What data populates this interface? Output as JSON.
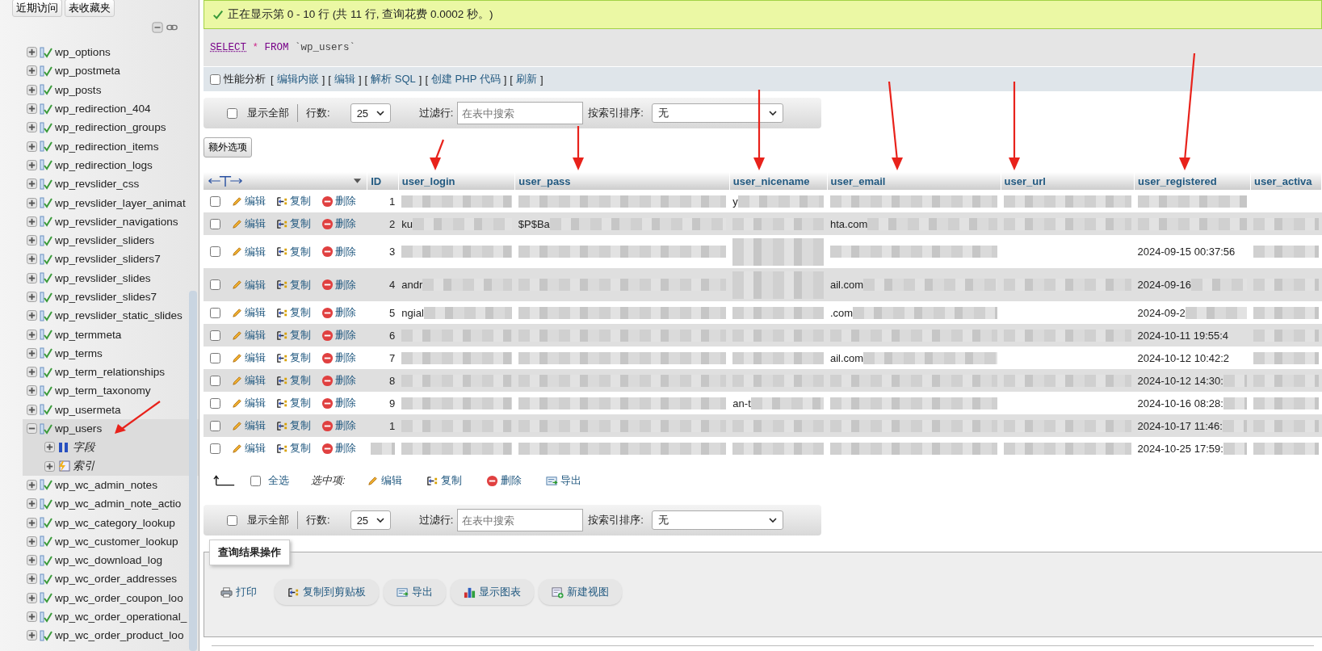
{
  "sidebar": {
    "buttons": [
      "近期访问",
      "表收藏夹"
    ],
    "tables": [
      {
        "name": "wp_options",
        "expanded": false,
        "selected": false,
        "annotated": false
      },
      {
        "name": "wp_postmeta",
        "expanded": false,
        "selected": false,
        "annotated": false
      },
      {
        "name": "wp_posts",
        "expanded": false,
        "selected": false,
        "annotated": false
      },
      {
        "name": "wp_redirection_404",
        "expanded": false,
        "selected": false,
        "annotated": false
      },
      {
        "name": "wp_redirection_groups",
        "expanded": false,
        "selected": false,
        "annotated": false
      },
      {
        "name": "wp_redirection_items",
        "expanded": false,
        "selected": false,
        "annotated": false
      },
      {
        "name": "wp_redirection_logs",
        "expanded": false,
        "selected": false,
        "annotated": false
      },
      {
        "name": "wp_revslider_css",
        "expanded": false,
        "selected": false,
        "annotated": false
      },
      {
        "name": "wp_revslider_layer_animat",
        "expanded": false,
        "selected": false,
        "annotated": false
      },
      {
        "name": "wp_revslider_navigations",
        "expanded": false,
        "selected": false,
        "annotated": false
      },
      {
        "name": "wp_revslider_sliders",
        "expanded": false,
        "selected": false,
        "annotated": false
      },
      {
        "name": "wp_revslider_sliders7",
        "expanded": false,
        "selected": false,
        "annotated": false
      },
      {
        "name": "wp_revslider_slides",
        "expanded": false,
        "selected": false,
        "annotated": false
      },
      {
        "name": "wp_revslider_slides7",
        "expanded": false,
        "selected": false,
        "annotated": false
      },
      {
        "name": "wp_revslider_static_slides",
        "expanded": false,
        "selected": false,
        "annotated": false
      },
      {
        "name": "wp_termmeta",
        "expanded": false,
        "selected": false,
        "annotated": false
      },
      {
        "name": "wp_terms",
        "expanded": false,
        "selected": false,
        "annotated": false
      },
      {
        "name": "wp_term_relationships",
        "expanded": false,
        "selected": false,
        "annotated": false
      },
      {
        "name": "wp_term_taxonomy",
        "expanded": false,
        "selected": false,
        "annotated": false
      },
      {
        "name": "wp_usermeta",
        "expanded": false,
        "selected": false,
        "annotated": false
      },
      {
        "name": "wp_users",
        "expanded": true,
        "selected": true,
        "annotated": true,
        "children": [
          {
            "name": "字段",
            "kind": "columns"
          },
          {
            "name": "索引",
            "kind": "indexes"
          }
        ]
      },
      {
        "name": "wp_wc_admin_notes",
        "expanded": false,
        "selected": false,
        "annotated": false
      },
      {
        "name": "wp_wc_admin_note_actio",
        "expanded": false,
        "selected": false,
        "annotated": false
      },
      {
        "name": "wp_wc_category_lookup",
        "expanded": false,
        "selected": false,
        "annotated": false
      },
      {
        "name": "wp_wc_customer_lookup",
        "expanded": false,
        "selected": false,
        "annotated": false
      },
      {
        "name": "wp_wc_download_log",
        "expanded": false,
        "selected": false,
        "annotated": false
      },
      {
        "name": "wp_wc_order_addresses",
        "expanded": false,
        "selected": false,
        "annotated": false
      },
      {
        "name": "wp_wc_order_coupon_loo",
        "expanded": false,
        "selected": false,
        "annotated": false
      },
      {
        "name": "wp_wc_order_operational_",
        "expanded": false,
        "selected": false,
        "annotated": false
      },
      {
        "name": "wp_wc_order_product_loo",
        "expanded": false,
        "selected": false,
        "annotated": false
      }
    ]
  },
  "message": "正在显示第 0 - 10 行 (共 11 行, 查询花费 0.0002 秒。)",
  "sql": [
    {
      "text": "SELECT",
      "kind": "keyword"
    },
    {
      "text": "*",
      "kind": "operator"
    },
    {
      "text": "FROM",
      "kind": "keyword"
    },
    {
      "text": "`wp_users`",
      "kind": "identifier"
    }
  ],
  "profiling": {
    "label": "性能分析",
    "checked": false,
    "links": [
      {
        "open": "[",
        "label": "编辑内嵌",
        "close": "]"
      },
      {
        "open": "[",
        "label": "编辑",
        "close": "]"
      },
      {
        "open": "[",
        "label": "解析 SQL",
        "close": "]"
      },
      {
        "open": "[",
        "label": "创建 PHP 代码",
        "close": "]"
      },
      {
        "open": "[",
        "label": "刷新",
        "close": "]"
      }
    ]
  },
  "navbars": [
    {
      "show_all": "显示全部",
      "checked": false,
      "rows_label": "行数:",
      "rows_value": "25",
      "filter_label": "过滤行:",
      "filter_placeholder": "在表中搜索",
      "sort_label": "按索引排序:",
      "sort_value": "无"
    },
    {
      "show_all": "显示全部",
      "checked": false,
      "rows_label": "行数:",
      "rows_value": "25",
      "filter_label": "过滤行:",
      "filter_placeholder": "在表中搜索",
      "sort_label": "按索引排序:",
      "sort_value": "无"
    }
  ],
  "extra_options": "额外选项",
  "table": {
    "columns": [
      {
        "label": "ID",
        "annotated": false
      },
      {
        "label": "user_login",
        "annotated": true
      },
      {
        "label": "user_pass",
        "annotated": true
      },
      {
        "label": "user_nicename",
        "annotated": true
      },
      {
        "label": "user_email",
        "annotated": true
      },
      {
        "label": "user_url",
        "annotated": true
      },
      {
        "label": "user_registered",
        "annotated": true
      },
      {
        "label": "user_activa",
        "annotated": false
      }
    ],
    "rows": [
      {
        "checked": false,
        "actions": [
          "编辑",
          "复制",
          "删除"
        ],
        "cells": [
          {
            "text": "1",
            "blurred": false
          },
          {
            "blurred": true
          },
          {
            "blurred": true
          },
          {
            "text": "y",
            "blurred": true
          },
          {
            "blurred": true
          },
          {
            "blurred": true
          },
          {
            "blurred": true
          },
          {
            "blurred": false
          }
        ]
      },
      {
        "checked": false,
        "actions": [
          "编辑",
          "复制",
          "删除"
        ],
        "cells": [
          {
            "text": "2",
            "blurred": false
          },
          {
            "text": "ku",
            "blurred": true
          },
          {
            "text": "$P$Ba",
            "blurred": true
          },
          {
            "blurred": true
          },
          {
            "text": "hta.com",
            "blurred": true
          },
          {
            "blurred": true
          },
          {
            "blurred": true
          },
          {
            "blurred": true
          }
        ]
      },
      {
        "checked": false,
        "actions": [
          "编辑",
          "复制",
          "删除"
        ],
        "cells": [
          {
            "text": "3",
            "blurred": false
          },
          {
            "blurred": true
          },
          {
            "blurred": true
          },
          {
            "blurred": true
          },
          {
            "blurred": true
          },
          {
            "blurred": false
          },
          {
            "text": "2024-09-15 00:37:56",
            "blurred": false
          },
          {
            "blurred": true
          }
        ]
      },
      {
        "checked": false,
        "actions": [
          "编辑",
          "复制",
          "删除"
        ],
        "cells": [
          {
            "text": "4",
            "blurred": false
          },
          {
            "text": "andr",
            "blurred": true
          },
          {
            "blurred": true
          },
          {
            "blurred": true
          },
          {
            "text": "ail.com",
            "blurred": true
          },
          {
            "blurred": true
          },
          {
            "text": "2024-09-16",
            "blurred": true
          },
          {
            "blurred": true
          }
        ]
      },
      {
        "checked": false,
        "actions": [
          "编辑",
          "复制",
          "删除"
        ],
        "cells": [
          {
            "text": "5",
            "blurred": false
          },
          {
            "text": "ngial",
            "blurred": true
          },
          {
            "blurred": true
          },
          {
            "blurred": true
          },
          {
            "text": ".com",
            "blurred": true
          },
          {
            "blurred": false
          },
          {
            "text": "2024-09-2",
            "blurred": true
          },
          {
            "blurred": true
          }
        ]
      },
      {
        "checked": false,
        "actions": [
          "编辑",
          "复制",
          "删除"
        ],
        "cells": [
          {
            "text": "6",
            "blurred": false
          },
          {
            "blurred": true
          },
          {
            "blurred": true
          },
          {
            "blurred": true
          },
          {
            "blurred": true
          },
          {
            "blurred": true
          },
          {
            "text": "2024-10-11 19:55:4",
            "blurred": false
          },
          {
            "blurred": true
          }
        ]
      },
      {
        "checked": false,
        "actions": [
          "编辑",
          "复制",
          "删除"
        ],
        "cells": [
          {
            "text": "7",
            "blurred": false
          },
          {
            "blurred": true
          },
          {
            "blurred": true
          },
          {
            "blurred": true
          },
          {
            "text": "ail.com",
            "blurred": true
          },
          {
            "blurred": false
          },
          {
            "text": "2024-10-12 10:42:2",
            "blurred": false
          },
          {
            "blurred": true
          }
        ]
      },
      {
        "checked": false,
        "actions": [
          "编辑",
          "复制",
          "删除"
        ],
        "cells": [
          {
            "text": "8",
            "blurred": false
          },
          {
            "blurred": true
          },
          {
            "blurred": true
          },
          {
            "blurred": true
          },
          {
            "blurred": true
          },
          {
            "blurred": true
          },
          {
            "text": "2024-10-12 14:30:",
            "blurred": true
          },
          {
            "blurred": true
          }
        ]
      },
      {
        "checked": false,
        "actions": [
          "编辑",
          "复制",
          "删除"
        ],
        "cells": [
          {
            "text": "9",
            "blurred": false
          },
          {
            "blurred": true
          },
          {
            "blurred": true
          },
          {
            "text": "an-t",
            "blurred": true
          },
          {
            "blurred": true
          },
          {
            "blurred": false
          },
          {
            "text": "2024-10-16 08:28:",
            "blurred": true
          },
          {
            "blurred": true
          }
        ]
      },
      {
        "checked": false,
        "actions": [
          "编辑",
          "复制",
          "删除"
        ],
        "cells": [
          {
            "text": "1",
            "blurred": false
          },
          {
            "blurred": true
          },
          {
            "blurred": true
          },
          {
            "blurred": true
          },
          {
            "blurred": true
          },
          {
            "blurred": true
          },
          {
            "text": "2024-10-17 11:46:",
            "blurred": true
          },
          {
            "blurred": true
          }
        ]
      },
      {
        "checked": false,
        "actions": [
          "编辑",
          "复制",
          "删除"
        ],
        "cells": [
          {
            "blurred": true
          },
          {
            "blurred": true
          },
          {
            "blurred": true
          },
          {
            "blurred": true
          },
          {
            "blurred": true
          },
          {
            "blurred": true
          },
          {
            "text": "2024-10-25 17:59:",
            "blurred": true
          },
          {
            "blurred": true
          }
        ]
      }
    ]
  },
  "bulk": {
    "check_all": "全选",
    "checked": false,
    "with_selected": "选中项:",
    "buttons": [
      {
        "kind": "edit",
        "label": "编辑"
      },
      {
        "kind": "copy",
        "label": "复制"
      },
      {
        "kind": "delete",
        "label": "删除"
      },
      {
        "kind": "export",
        "label": "导出"
      }
    ]
  },
  "query_ops": {
    "legend": "查询结果操作",
    "buttons": [
      {
        "kind": "print",
        "label": "打印"
      },
      {
        "kind": "copy",
        "label": "复制到剪贴板"
      },
      {
        "kind": "export",
        "label": "导出"
      },
      {
        "kind": "chart",
        "label": "显示图表"
      },
      {
        "kind": "view",
        "label": "新建视图"
      }
    ]
  }
}
